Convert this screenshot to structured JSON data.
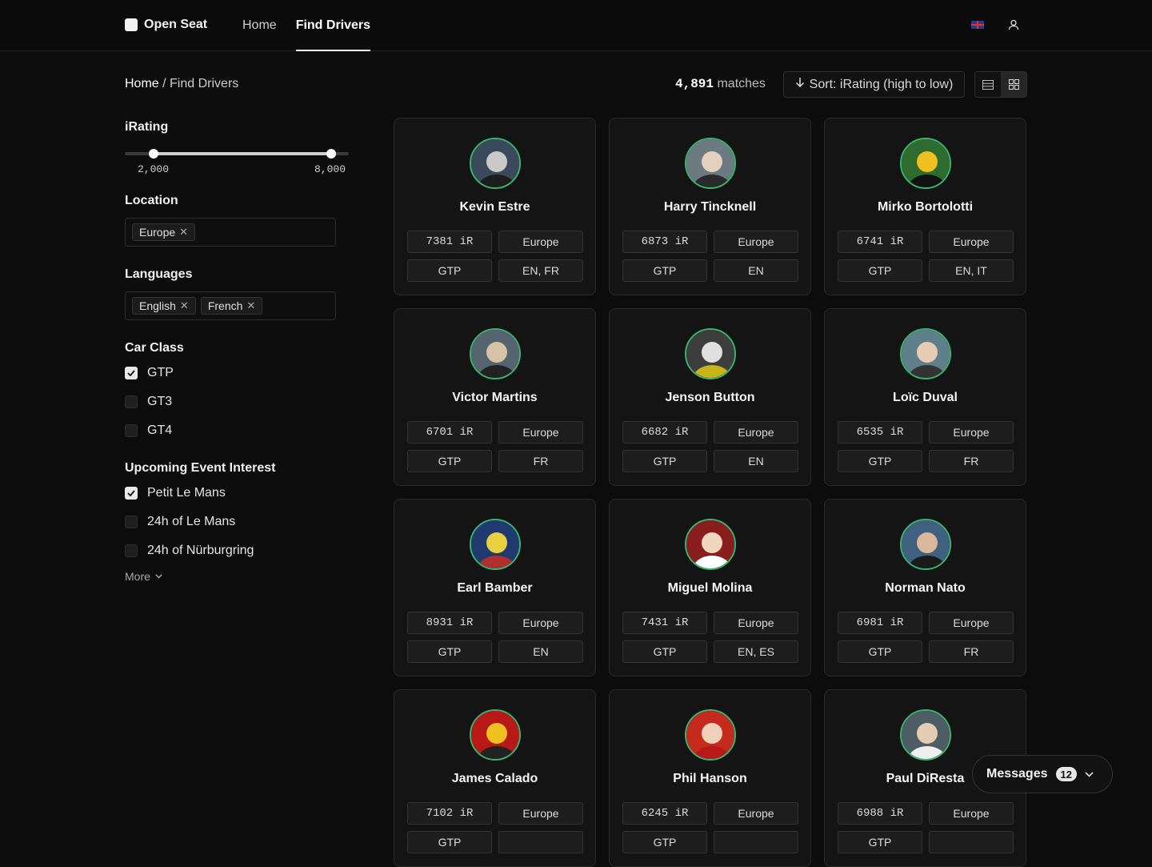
{
  "brand": {
    "name": "Open Seat"
  },
  "nav": [
    {
      "label": "Home"
    },
    {
      "label": "Find Drivers"
    }
  ],
  "breadcrumb": {
    "home": "Home",
    "sep": " / ",
    "current": "Find Drivers"
  },
  "results": {
    "count": "4,891",
    "suffix": " matches",
    "sort_label": "Sort: iRating (high to low)"
  },
  "filters": {
    "irating": {
      "title": "iRating",
      "min": "2,000",
      "max": "8,000"
    },
    "location": {
      "title": "Location",
      "chips": [
        "Europe"
      ]
    },
    "languages": {
      "title": "Languages",
      "chips": [
        "English",
        "French"
      ]
    },
    "car_class": {
      "title": "Car Class",
      "options": [
        {
          "label": "GTP",
          "checked": true
        },
        {
          "label": "GT3",
          "checked": false
        },
        {
          "label": "GT4",
          "checked": false
        }
      ]
    },
    "events": {
      "title": "Upcoming Event Interest",
      "options": [
        {
          "label": "Petit Le Mans",
          "checked": true
        },
        {
          "label": "24h of Le Mans",
          "checked": false
        },
        {
          "label": "24h of Nürburgring",
          "checked": false
        }
      ],
      "more_label": "More"
    }
  },
  "drivers": [
    {
      "name": "Kevin Estre",
      "irating": "7381 iR",
      "region": "Europe",
      "class": "GTP",
      "langs": "EN, FR"
    },
    {
      "name": "Harry Tincknell",
      "irating": "6873 iR",
      "region": "Europe",
      "class": "GTP",
      "langs": "EN"
    },
    {
      "name": "Mirko Bortolotti",
      "irating": "6741 iR",
      "region": "Europe",
      "class": "GTP",
      "langs": "EN, IT"
    },
    {
      "name": "Victor Martins",
      "irating": "6701 iR",
      "region": "Europe",
      "class": "GTP",
      "langs": "FR"
    },
    {
      "name": "Jenson Button",
      "irating": "6682 iR",
      "region": "Europe",
      "class": "GTP",
      "langs": "EN"
    },
    {
      "name": "Loïc Duval",
      "irating": "6535 iR",
      "region": "Europe",
      "class": "GTP",
      "langs": "FR"
    },
    {
      "name": "Earl Bamber",
      "irating": "8931 iR",
      "region": "Europe",
      "class": "GTP",
      "langs": "EN"
    },
    {
      "name": "Miguel Molina",
      "irating": "7431 iR",
      "region": "Europe",
      "class": "GTP",
      "langs": "EN, ES"
    },
    {
      "name": "Norman Nato",
      "irating": "6981 iR",
      "region": "Europe",
      "class": "GTP",
      "langs": "FR"
    },
    {
      "name": "James Calado",
      "irating": "7102 iR",
      "region": "Europe",
      "class": "GTP",
      "langs": ""
    },
    {
      "name": "Phil Hanson",
      "irating": "6245 iR",
      "region": "Europe",
      "class": "GTP",
      "langs": ""
    },
    {
      "name": "Paul DiResta",
      "irating": "6988 iR",
      "region": "Europe",
      "class": "GTP",
      "langs": ""
    }
  ],
  "messages": {
    "label": "Messages",
    "count": "12"
  },
  "colors": {
    "accent": "#3cb371",
    "background": "#0c0c0c",
    "card": "#141414"
  }
}
